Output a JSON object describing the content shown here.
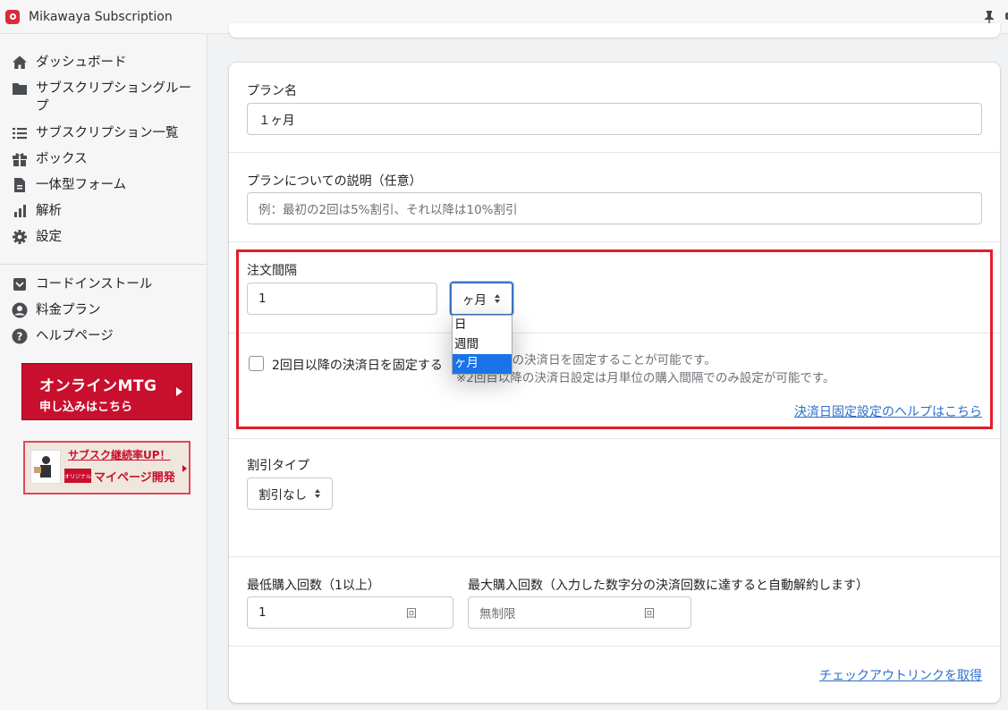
{
  "window": {
    "title": "Mikawaya Subscription"
  },
  "sidebar": {
    "items": [
      {
        "label": "ダッシュボード",
        "icon": "home-icon"
      },
      {
        "label": "サブスクリプショングループ",
        "icon": "folder-icon"
      },
      {
        "label": "サブスクリプション一覧",
        "icon": "list-icon"
      },
      {
        "label": "ボックス",
        "icon": "gift-icon"
      },
      {
        "label": "一体型フォーム",
        "icon": "document-icon"
      },
      {
        "label": "解析",
        "icon": "bar-chart-icon"
      },
      {
        "label": "設定",
        "icon": "gear-icon"
      }
    ],
    "secondary": [
      {
        "label": "コードインストール",
        "icon": "code-install-icon"
      },
      {
        "label": "料金プラン",
        "icon": "account-icon"
      },
      {
        "label": "ヘルプページ",
        "icon": "help-icon"
      }
    ],
    "banner_mtg": {
      "line1": "オンラインMTG",
      "line2": "申し込みはこちら"
    },
    "banner_sub": {
      "line1": "サブスク継続率UP！",
      "tag": "オリジナル",
      "line2": "マイページ開発"
    }
  },
  "form": {
    "plan_name": {
      "label": "プラン名",
      "value": "１ヶ月"
    },
    "plan_description": {
      "label": "プランについての説明（任意）",
      "placeholder": "例：最初の2回は5%割引、それ以降は10%割引"
    },
    "order_interval": {
      "label": "注文間隔",
      "value": "1",
      "unit_selected": "ヶ月",
      "unit_options": [
        "日",
        "週間",
        "ヶ月"
      ]
    },
    "fix_billing_date": {
      "label": "2回目以降の決済日を固定する",
      "hint_line1": "2回目以降の決済日を固定することが可能です。",
      "hint_line2": "※2回目以降の決済日設定は月単位の購入間隔でのみ設定が可能です。",
      "help_link": "決済日固定設定のヘルプはこちら"
    },
    "discount_type": {
      "label": "割引タイプ",
      "value": "割引なし"
    },
    "min_purchases": {
      "label": "最低購入回数（1以上）",
      "value": "1",
      "suffix": "回"
    },
    "max_purchases": {
      "label": "最大購入回数（入力した数字分の決済回数に達すると自動解約します）",
      "placeholder": "無制限",
      "suffix": "回"
    },
    "checkout_link": "チェックアウトリンクを取得"
  },
  "colors": {
    "accent": "#2c6ecb",
    "highlight_border": "#e11e2c",
    "brand": "#c8102e",
    "selected_option": "#1a73e8"
  }
}
